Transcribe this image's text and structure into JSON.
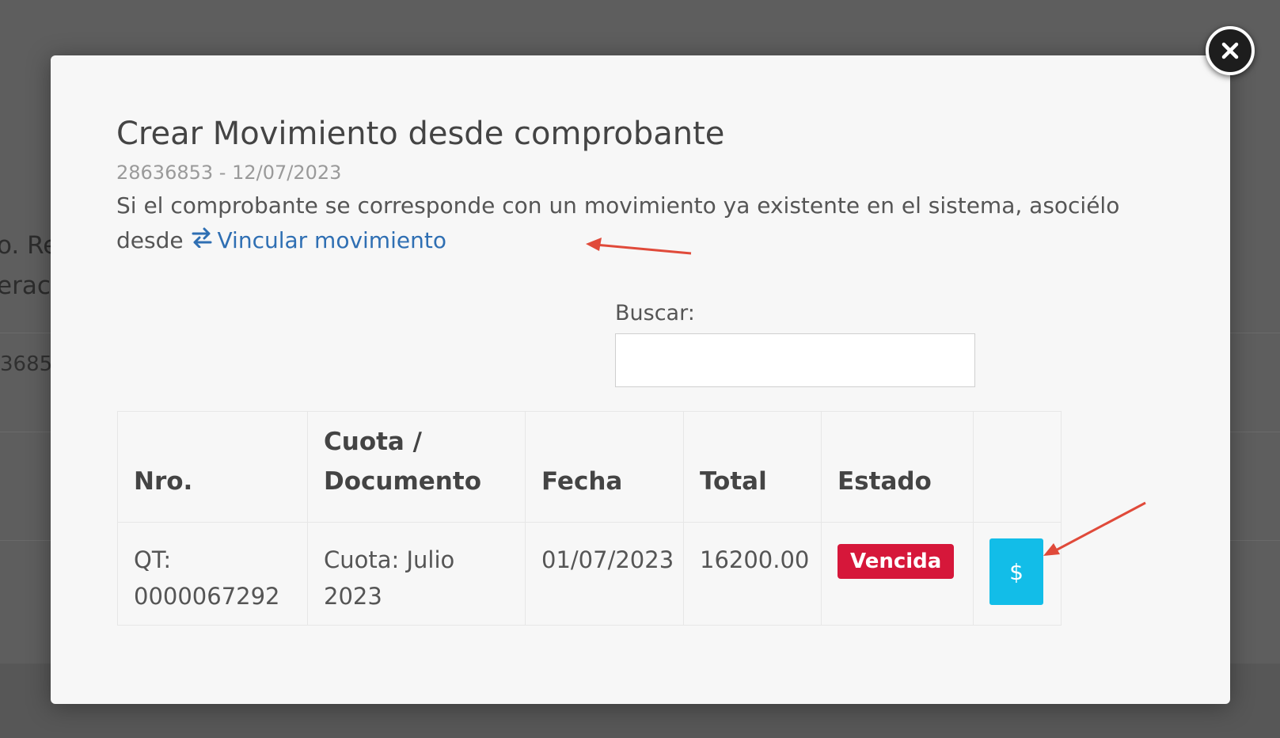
{
  "background": {
    "text_1": "o. Re",
    "text_2": "erac",
    "text_3": "3685"
  },
  "modal": {
    "close_icon": "close-icon",
    "title": "Crear Movimiento desde comprobante",
    "subtitle": "28636853 - 12/07/2023",
    "description_prefix": "Si el comprobante se corresponde con un movimiento ya existente en el sistema, asociélo desde",
    "link_icon": "exchange-arrows-icon",
    "link_label": "Vincular movimiento"
  },
  "search": {
    "label": "Buscar:",
    "value": ""
  },
  "table": {
    "headers": [
      "Nro.",
      "Cuota / Documento",
      "Fecha",
      "Total",
      "Estado",
      ""
    ],
    "rows": [
      {
        "nro": "QT: 0000067292",
        "cuota": "Cuota: Julio 2023",
        "fecha": "01/07/2023",
        "total": "16200.00",
        "estado": "Vencida",
        "action_label": "$"
      }
    ]
  },
  "colors": {
    "link": "#2f6fb3",
    "badge_vencida": "#d6173a",
    "pay_button": "#12bde8",
    "annotation_arrow": "#e04a3a"
  }
}
